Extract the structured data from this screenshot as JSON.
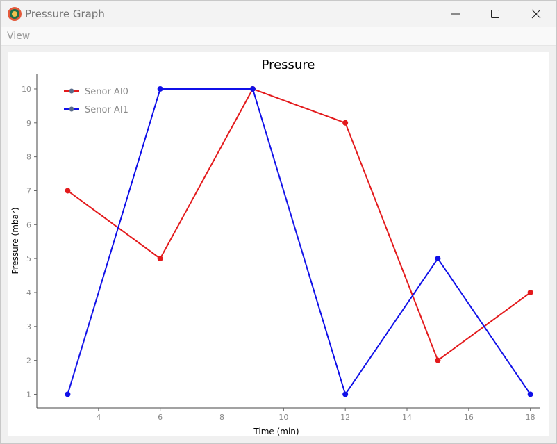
{
  "window": {
    "title": "Pressure Graph",
    "minimize_label": "—",
    "maximize_label": "☐",
    "close_label": "✕"
  },
  "menu": {
    "items": [
      "View"
    ]
  },
  "chart_data": {
    "type": "line",
    "title": "Pressure",
    "xlabel": "Time (min)",
    "ylabel": "Pressure (mbar)",
    "x": [
      3,
      6,
      9,
      12,
      15,
      18
    ],
    "xlim": [
      2,
      18.3
    ],
    "ylim": [
      0.6,
      10.45
    ],
    "xticks": [
      4,
      6,
      8,
      10,
      12,
      14,
      16,
      18
    ],
    "yticks": [
      1,
      2,
      3,
      4,
      5,
      6,
      7,
      8,
      9,
      10
    ],
    "grid": false,
    "legend_position": "top-left",
    "series": [
      {
        "name": "Senor AI0",
        "values": [
          7,
          5,
          10,
          9,
          2,
          4
        ],
        "color": "#e31a1c"
      },
      {
        "name": "Senor AI1",
        "values": [
          1,
          10,
          10,
          1,
          5,
          1
        ],
        "color": "#1010e8"
      }
    ]
  }
}
